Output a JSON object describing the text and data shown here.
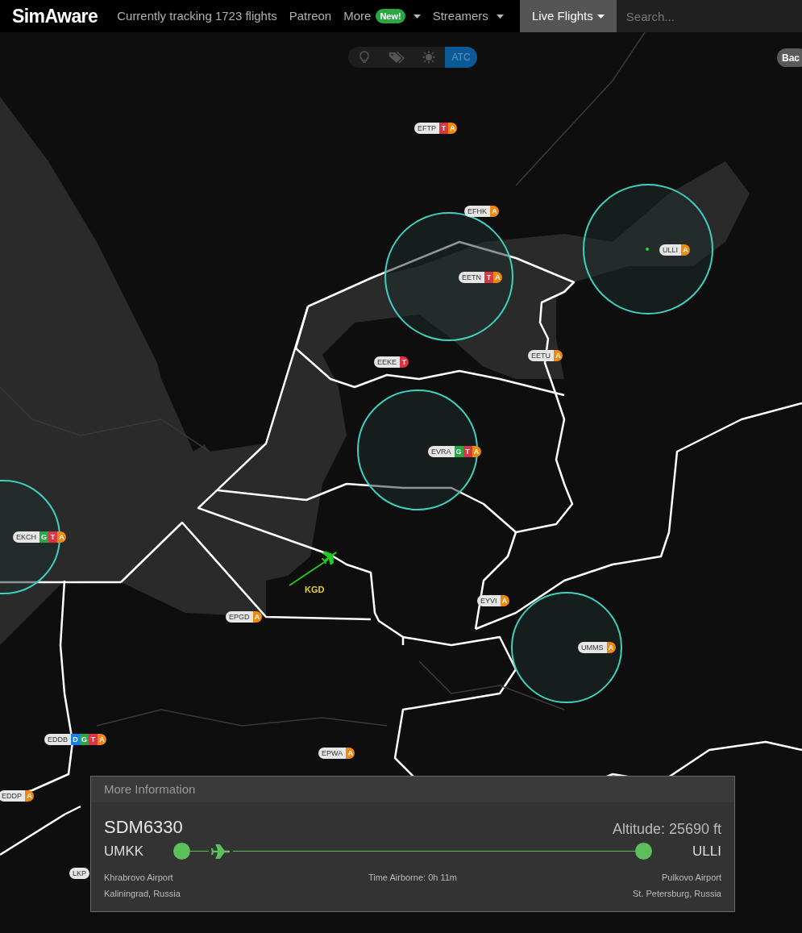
{
  "navbar": {
    "brand": "SimAware",
    "tracking": "Currently tracking 1723 flights",
    "links": [
      {
        "label": "Patreon",
        "kind": "link"
      },
      {
        "label": "More",
        "kind": "dropdown",
        "badge": "New!"
      },
      {
        "label": "Streamers",
        "kind": "dropdown"
      }
    ],
    "live_flights": "Live Flights",
    "search": {
      "placeholder": "Search..."
    }
  },
  "map_toolbar": [
    {
      "kind": "bulb",
      "selected": false
    },
    {
      "kind": "tags",
      "selected": false
    },
    {
      "kind": "sun",
      "selected": false
    },
    {
      "kind": "text",
      "label": "ATC",
      "selected": true
    }
  ],
  "corner_button": "Bac",
  "airports": [
    {
      "code": "EFTP",
      "circle": false,
      "services": [
        {
          "label": "T",
          "color": "#dc3545"
        },
        {
          "label": "A",
          "color": "#f0870f"
        }
      ]
    },
    {
      "code": "EFHK",
      "circle": false,
      "services": [
        {
          "label": "A",
          "color": "#f0870f"
        }
      ]
    },
    {
      "code": "ULLI",
      "circle": true,
      "services": [
        {
          "label": "A",
          "color": "#f0870f"
        }
      ]
    },
    {
      "code": "EETN",
      "circle": true,
      "services": [
        {
          "label": "T",
          "color": "#dc3545"
        },
        {
          "label": "A",
          "color": "#f0870f"
        }
      ]
    },
    {
      "code": "EEKE",
      "circle": false,
      "services": [
        {
          "label": "T",
          "color": "#dc3545"
        }
      ]
    },
    {
      "code": "EETU",
      "circle": false,
      "services": [
        {
          "label": "A",
          "color": "#f0870f"
        }
      ]
    },
    {
      "code": "EVRA",
      "circle": true,
      "services": [
        {
          "label": "G",
          "color": "#28a745"
        },
        {
          "label": "T",
          "color": "#dc3545"
        },
        {
          "label": "A",
          "color": "#f0870f"
        }
      ]
    },
    {
      "code": "EKCH",
      "circle": true,
      "services": [
        {
          "label": "G",
          "color": "#28a745"
        },
        {
          "label": "T",
          "color": "#dc3545"
        },
        {
          "label": "A",
          "color": "#f0870f"
        }
      ]
    },
    {
      "code": "EYVI",
      "circle": false,
      "services": [
        {
          "label": "A",
          "color": "#f0870f"
        }
      ]
    },
    {
      "code": "UMMS",
      "circle": true,
      "services": [
        {
          "label": "A",
          "color": "#f0870f"
        }
      ]
    },
    {
      "code": "EPGD",
      "circle": false,
      "services": [
        {
          "label": "A",
          "color": "#f0870f"
        }
      ]
    },
    {
      "code": "EDDB",
      "circle": false,
      "services": [
        {
          "label": "D",
          "color": "#1a7fe0"
        },
        {
          "label": "G",
          "color": "#28a745"
        },
        {
          "label": "T",
          "color": "#dc3545"
        },
        {
          "label": "A",
          "color": "#f0870f"
        }
      ]
    },
    {
      "code": "EPWA",
      "circle": false,
      "services": [
        {
          "label": "A",
          "color": "#f0870f"
        }
      ]
    },
    {
      "code": "EDDP",
      "circle": false,
      "services": [
        {
          "label": "A",
          "color": "#f0870f"
        }
      ]
    },
    {
      "code": "LKP",
      "circle": false
    }
  ],
  "flight": {
    "label": "KGD"
  },
  "info_panel": {
    "title": "More Information",
    "callsign": "SDM6330",
    "altitude": "Altitude: 25690 ft",
    "origin": {
      "code": "UMKK",
      "name": "Khrabrovo Airport",
      "city": "Kaliningrad, Russia"
    },
    "destination": {
      "code": "ULLI",
      "name": "Pulkovo Airport",
      "city": "St. Petersburg, Russia"
    },
    "progress": {
      "level": 0.08
    },
    "time_airborne": "Time Airborne: 0h 11m"
  }
}
